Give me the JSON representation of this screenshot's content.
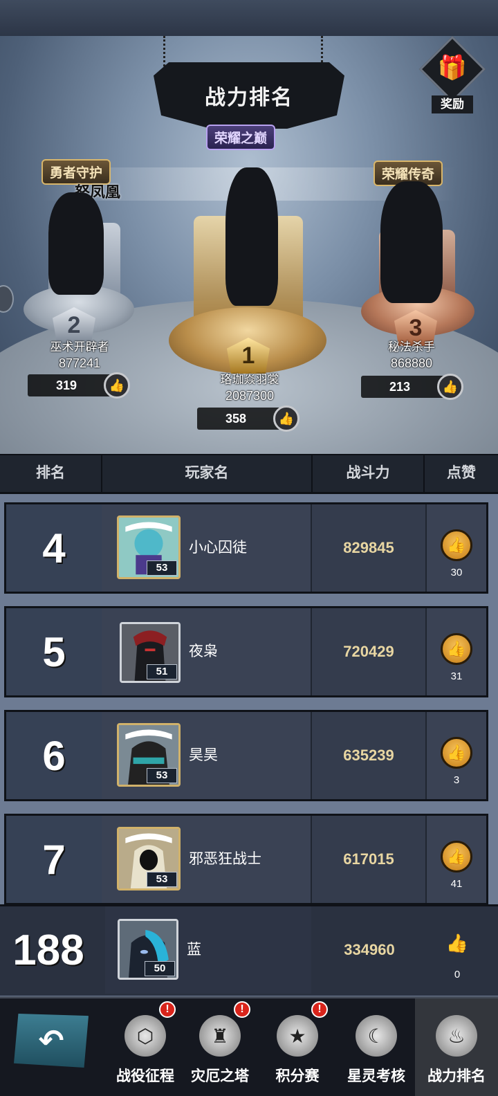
{
  "header": {
    "title": "战力排名",
    "reward_label": "奖励",
    "peak_badge": "荣耀之巅"
  },
  "podium": {
    "second": {
      "rank": "2",
      "badge": "勇者守护",
      "subtitle": "怒凤凰",
      "name": "巫术开辟者",
      "power": "877241",
      "likes": "319"
    },
    "first": {
      "rank": "1",
      "name": "珞珈焱羽裳",
      "power": "2087300",
      "likes": "358"
    },
    "third": {
      "rank": "3",
      "badge": "荣耀传奇",
      "name": "秘法杀手",
      "power": "868880",
      "likes": "213"
    }
  },
  "table": {
    "headers": {
      "rank": "排名",
      "name": "玩家名",
      "power": "战斗力",
      "like": "点赞"
    }
  },
  "rows": [
    {
      "rank": "4",
      "name": "小心囚徒",
      "power": "829845",
      "likes": "30",
      "level": "53"
    },
    {
      "rank": "5",
      "name": "夜枭",
      "power": "720429",
      "likes": "31",
      "level": "51"
    },
    {
      "rank": "6",
      "name": "昊昊",
      "power": "635239",
      "likes": "3",
      "level": "53"
    },
    {
      "rank": "7",
      "name": "邪恶狂战士",
      "power": "617015",
      "likes": "41",
      "level": "53"
    }
  ],
  "self_row": {
    "rank": "188",
    "name": "蓝",
    "power": "334960",
    "likes": "0",
    "level": "50"
  },
  "nav": {
    "back_icon": "back-arrow-icon",
    "items": [
      {
        "label": "战役征程",
        "icon": "shield-icon",
        "alert": "!"
      },
      {
        "label": "灾厄之塔",
        "icon": "tower-icon",
        "alert": "!"
      },
      {
        "label": "积分赛",
        "icon": "star-emblem-icon",
        "alert": "!"
      },
      {
        "label": "星灵考核",
        "icon": "crescent-moon-icon"
      },
      {
        "label": "战力排名",
        "icon": "flame-rank-icon"
      }
    ]
  },
  "colors": {
    "gold_text": "#e8d6a2",
    "row_bg": "#202631",
    "nav_bg": "#151820"
  }
}
